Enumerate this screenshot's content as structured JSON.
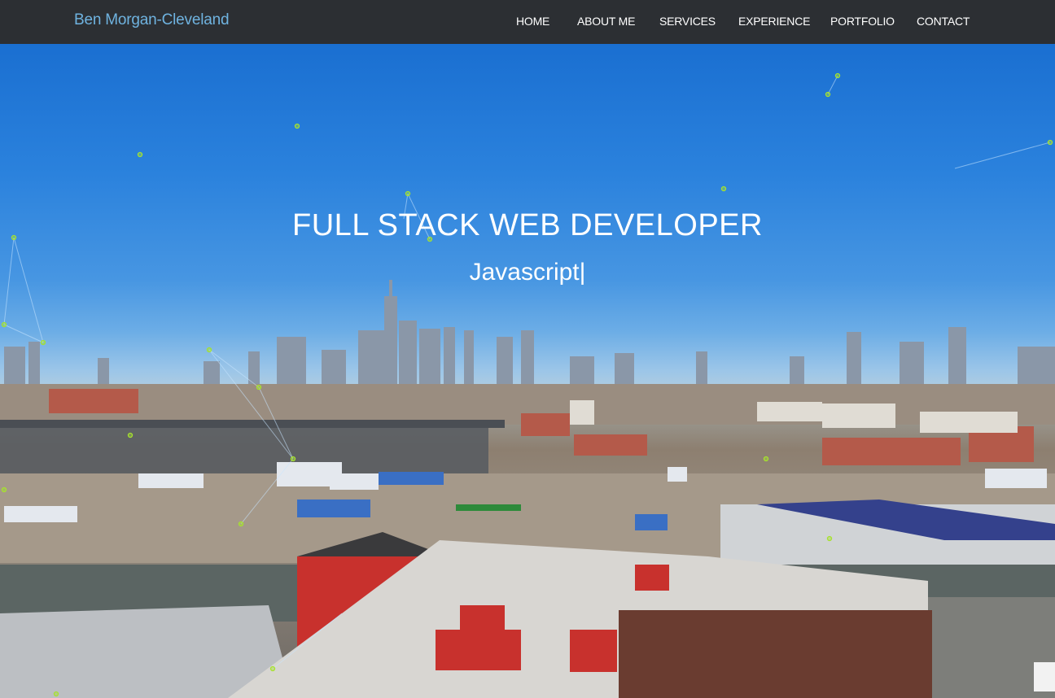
{
  "brand": {
    "name": "Ben Morgan-Cleveland"
  },
  "nav": {
    "items": [
      {
        "label": "HOME"
      },
      {
        "label": "ABOUT ME"
      },
      {
        "label": "SERVICES"
      },
      {
        "label": "EXPERIENCE"
      },
      {
        "label": "PORTFOLIO"
      },
      {
        "label": "CONTACT"
      }
    ]
  },
  "hero": {
    "title": "FULL STACK WEB DEVELOPER",
    "typed_text": "Javascript",
    "cursor": "|"
  },
  "colors": {
    "navbar_bg": "#2c2f33",
    "brand": "#6fb3e0",
    "particle": "#a6e22e"
  }
}
